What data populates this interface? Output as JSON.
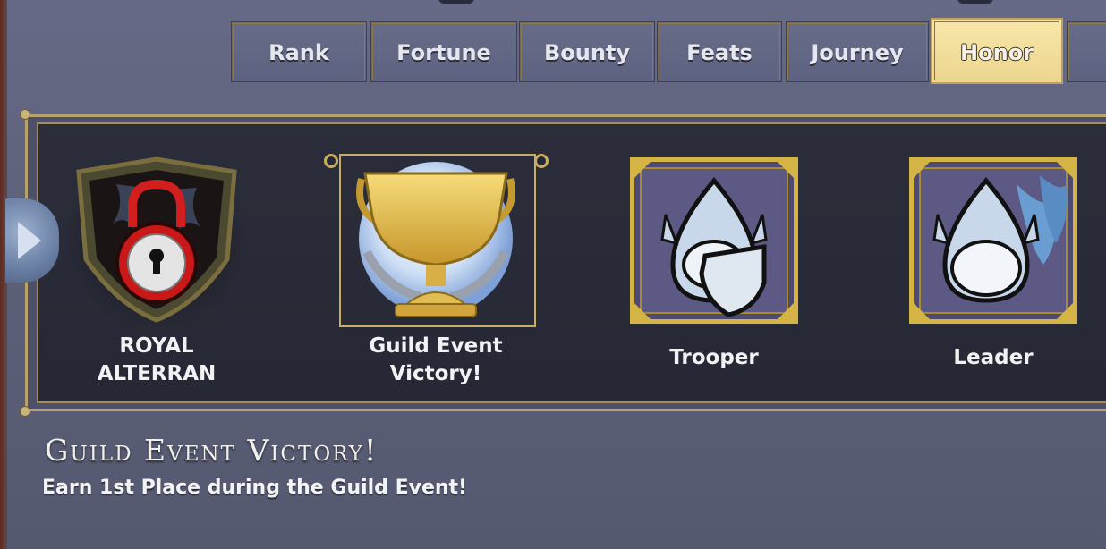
{
  "tabs": [
    {
      "label": "Rank",
      "active": false
    },
    {
      "label": "Fortune",
      "active": false
    },
    {
      "label": "Bounty",
      "active": false
    },
    {
      "label": "Feats",
      "active": false
    },
    {
      "label": "Journey",
      "active": false
    },
    {
      "label": "Honor",
      "active": true
    }
  ],
  "achievements": [
    {
      "label": "ROYAL ALTERRAN",
      "icon": "locked-shield-icon",
      "locked": true
    },
    {
      "label": "Guild Event Victory!",
      "icon": "gold-trophy-icon",
      "selected": true
    },
    {
      "label": "Trooper",
      "icon": "helmet-shield-icon"
    },
    {
      "label": "Leader",
      "icon": "helmet-flames-icon"
    }
  ],
  "detail": {
    "title": "Guild Event Victory!",
    "description": "Earn 1st Place during the Guild Event!"
  },
  "colors": {
    "active_tab": "#f3e3a0",
    "frame_gold": "#c8ae62",
    "panel_bg": "#282a36",
    "page_bg": "#606480"
  }
}
